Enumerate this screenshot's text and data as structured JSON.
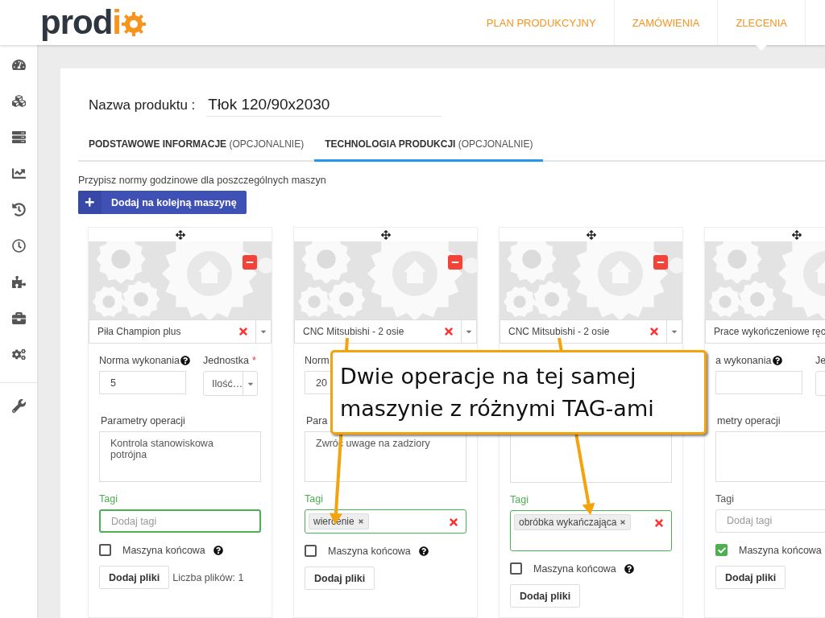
{
  "header": {
    "logo": {
      "text": "prod",
      "accent": "i"
    },
    "nav": [
      {
        "label": "PLAN PRODUKCYJNY",
        "selected": false
      },
      {
        "label": "ZAMÓWIENIA",
        "selected": false
      },
      {
        "label": "ZLECENIA",
        "selected": true
      }
    ]
  },
  "product": {
    "label": "Nazwa produktu :",
    "value": "Tłok 120/90x2030"
  },
  "tabs": [
    {
      "label": "PODSTAWOWE INFORMACJE",
      "suffix": "(OPCJONALNIE)",
      "selected": false
    },
    {
      "label": "TECHNOLOGIA PRODUKCJI",
      "suffix": "(OPCJONALNIE)",
      "selected": true
    }
  ],
  "instructions": "Przypisz normy godzinowe dla poszczególnych maszyn",
  "add_button": {
    "label": "Dodaj na kolejną maszynę"
  },
  "machines": [
    {
      "name": "Piła Champion plus",
      "removable": true,
      "clearable": true,
      "norm_label": "Norma wykonania",
      "norm_help": true,
      "norm": "5",
      "unit_label": "Jednostka",
      "required_mark": "*",
      "unit": "Ilość…",
      "params_label": "Parametry operacji",
      "params": "Kontrola stanowiskowa potrójna",
      "tags_label": "Tagi",
      "tags_valid": true,
      "tags_focused": true,
      "tags_placeholder": "Dodaj tagi",
      "final_label": "Maszyna końcowa",
      "final": false,
      "files_button": "Dodaj pliki",
      "files_count": "Liczba plików: 1"
    },
    {
      "name": "CNC Mitsubishi - 2 osie",
      "removable": true,
      "clearable": true,
      "norm_label": "Norm",
      "norm": "20",
      "params_label": "Para",
      "params": "Zwróć uwage na zadziory",
      "tags_label": "Tagi",
      "tags_valid": true,
      "tags_focused": false,
      "tags": [
        "wiercenie"
      ],
      "final_label": "Maszyna końcowa",
      "final": false,
      "files_button": "Dodaj pliki"
    },
    {
      "name": "CNC Mitsubishi - 2 osie",
      "removable": true,
      "clearable": true,
      "tags_label": "Tagi",
      "tags_valid": true,
      "tags_focused": false,
      "tags": [
        "obróbka wykańczająca"
      ],
      "final_label": "Maszyna końcowa",
      "final": false,
      "files_button": "Dodaj pliki"
    },
    {
      "name": "Prace wykończeniowe ręc",
      "norm_label": "a wykonania",
      "norm_help": true,
      "unit_label": "Je",
      "params_label": "metry operacji",
      "tags_label": "Tagi",
      "tags_valid": false,
      "tags_focused": false,
      "tags_placeholder": "Dodaj tagi",
      "final_label": "Maszyna końcowa",
      "final": true,
      "files_button": "Dodaj pliki"
    }
  ],
  "callout": {
    "text": "Dwie operacje na tej samej\nmaszynie z różnymi TAG-ami"
  }
}
